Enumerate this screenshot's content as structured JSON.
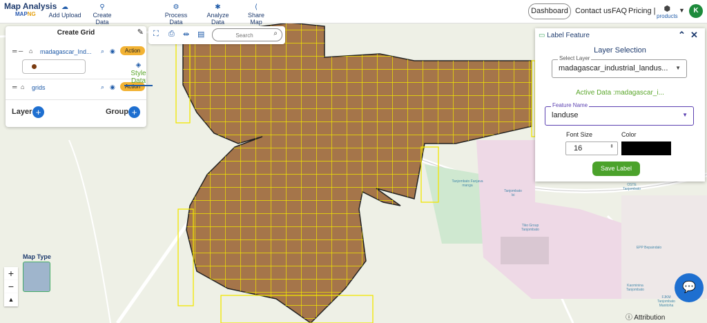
{
  "topbar": {
    "logo_line1": "Map Analysis",
    "logo_map": "MAP",
    "logo_ng": "NG",
    "nav": [
      {
        "label": "Add Upload",
        "icon": "cloud-upload-icon",
        "glyph": "☁"
      },
      {
        "label": "Create Data",
        "icon": "map-pin-icon",
        "glyph": "📍"
      },
      {
        "label": "Style Data",
        "icon": "paint-bucket-icon",
        "glyph": "◆"
      },
      {
        "label": "Process Data",
        "icon": "process-icon",
        "glyph": "⚙"
      },
      {
        "label": "Analyze Data",
        "icon": "analyze-icon",
        "glyph": "✱"
      },
      {
        "label": "Share Map",
        "icon": "share-icon",
        "glyph": "⟨"
      }
    ],
    "dashboard": "Dashboard",
    "contact": "Contact us",
    "faq": "FAQ",
    "pricing": "Pricing |",
    "products": "products",
    "avatar": "K"
  },
  "left_panel": {
    "title": "Create Grid",
    "layers": [
      {
        "name": "madagascar_Ind...",
        "action": "Action"
      },
      {
        "name": "grids",
        "action": "Action"
      }
    ],
    "layer_label": "Layer",
    "group_label": "Group"
  },
  "toolbar": {
    "search_placeholder": "Search"
  },
  "label_feature": {
    "title": "Label Feature",
    "subtitle": "Layer Selection",
    "select_layer_label": "Select Layer",
    "select_layer_value": "madagascar_industrial_landus...",
    "active_data": "Active Data :madagascar_i...",
    "feature_name_label": "Feature Name",
    "feature_name_value": "landuse",
    "font_size_label": "Font Size",
    "font_size_value": "16",
    "color_label": "Color",
    "color_value": "#000000",
    "save_label": "Save Label"
  },
  "map": {
    "map_type": "Map Type",
    "attribution": "Attribution",
    "zoom_in": "+",
    "zoom_out": "−",
    "reset_north": "▲",
    "place_labels": [
      "Tanjombato Fanjava manga",
      "Tanjombato Isi",
      "Tiko Group Tanjombato",
      "OSTE Tanjombato",
      "EPP Bepaindalo",
      "Kaominina Tanjombato",
      "FJKM Tanjombato Manitoha"
    ]
  },
  "colors": {
    "primary": "#1e5aa8",
    "action": "#f2b233",
    "polygon_fill": "#a5754a",
    "grid_line": "#f2e600",
    "save_button": "#4ba22b",
    "active_text": "#5aa62a"
  }
}
